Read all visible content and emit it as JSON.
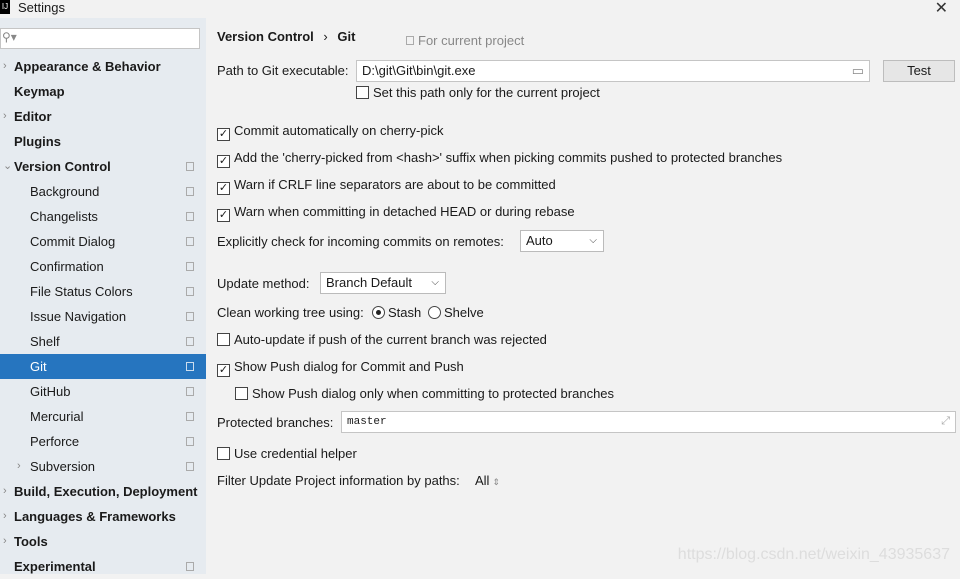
{
  "window": {
    "title": "Settings",
    "close": "✕"
  },
  "search": {
    "placeholder": "",
    "icon": "search-icon"
  },
  "sidebar": {
    "items": [
      {
        "label": "Appearance & Behavior",
        "level": 0,
        "expandable": true
      },
      {
        "label": "Keymap",
        "level": 0
      },
      {
        "label": "Editor",
        "level": 0,
        "expandable": true
      },
      {
        "label": "Plugins",
        "level": 0
      },
      {
        "label": "Version Control",
        "level": 0,
        "expanded": true,
        "project": true
      },
      {
        "label": "Background",
        "level": 1,
        "project": true
      },
      {
        "label": "Changelists",
        "level": 1,
        "project": true
      },
      {
        "label": "Commit Dialog",
        "level": 1,
        "project": true
      },
      {
        "label": "Confirmation",
        "level": 1,
        "project": true
      },
      {
        "label": "File Status Colors",
        "level": 1,
        "project": true
      },
      {
        "label": "Issue Navigation",
        "level": 1,
        "project": true
      },
      {
        "label": "Shelf",
        "level": 1,
        "project": true
      },
      {
        "label": "Git",
        "level": 1,
        "project": true,
        "selected": true
      },
      {
        "label": "GitHub",
        "level": 1,
        "project": true
      },
      {
        "label": "Mercurial",
        "level": 1,
        "project": true
      },
      {
        "label": "Perforce",
        "level": 1,
        "project": true
      },
      {
        "label": "Subversion",
        "level": 1,
        "project": true,
        "expandable": true
      },
      {
        "label": "Build, Execution, Deployment",
        "level": 0,
        "expandable": true
      },
      {
        "label": "Languages & Frameworks",
        "level": 0,
        "expandable": true
      },
      {
        "label": "Tools",
        "level": 0,
        "expandable": true
      },
      {
        "label": "Experimental",
        "level": 0,
        "project": true
      }
    ]
  },
  "breadcrumb": {
    "parent": "Version Control",
    "sep": "›",
    "current": "Git",
    "scope": "For current project"
  },
  "git": {
    "path_label": "Path to Git executable:",
    "path_value": "D:\\git\\Git\\bin\\git.exe",
    "test": "Test",
    "path_project_only": {
      "label": "Set this path only for the current project",
      "checked": false
    },
    "checks": [
      {
        "label": "Commit automatically on cherry-pick",
        "checked": true
      },
      {
        "label": "Add the 'cherry-picked from <hash>' suffix when picking commits pushed to protected branches",
        "checked": true
      },
      {
        "label": "Warn if CRLF line separators are about to be committed",
        "checked": true
      },
      {
        "label": "Warn when committing in detached HEAD or during rebase",
        "checked": true
      }
    ],
    "incoming_label": "Explicitly check for incoming commits on remotes:",
    "incoming_value": "Auto",
    "update_label": "Update method:",
    "update_value": "Branch Default",
    "clean_label": "Clean working tree using:",
    "stash": "Stash",
    "shelve": "Shelve",
    "clean_selected": "Stash",
    "auto_update": {
      "label": "Auto-update if push of the current branch was rejected",
      "checked": false
    },
    "show_push": {
      "label": "Show Push dialog for Commit and Push",
      "checked": true
    },
    "show_push_protected": {
      "label": "Show Push dialog only when committing to protected branches",
      "checked": false
    },
    "protected_label": "Protected branches:",
    "protected_value": "master",
    "credential": {
      "label": "Use credential helper",
      "checked": false
    },
    "filter_label": "Filter Update Project information by paths:",
    "filter_value": "All"
  },
  "watermark": "https://blog.csdn.net/weixin_43935637"
}
